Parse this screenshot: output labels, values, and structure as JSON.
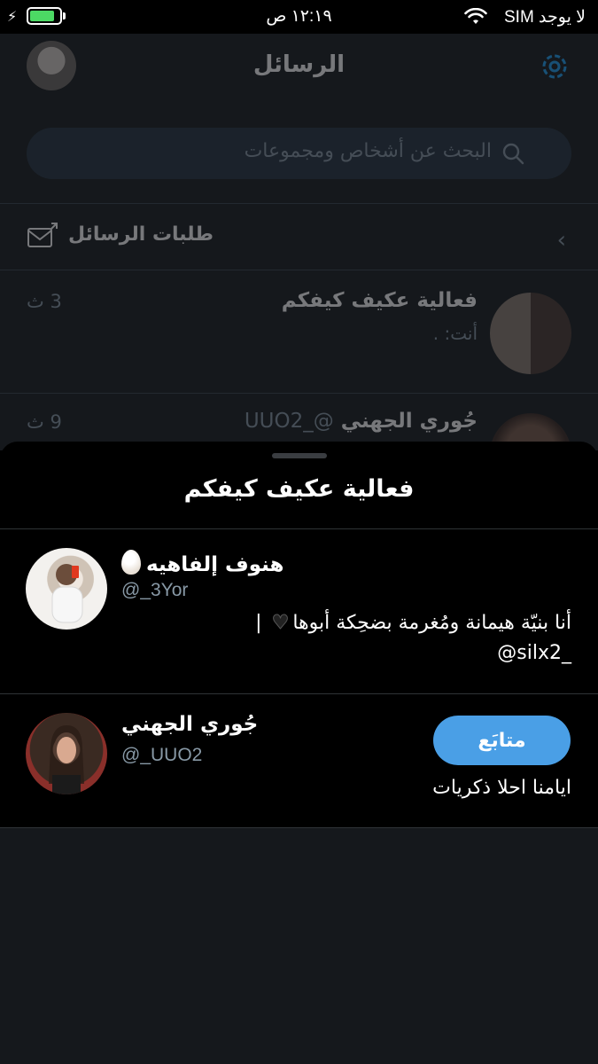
{
  "status_bar": {
    "carrier": "لا يوجد SIM",
    "time": "١٢:١٩ ص",
    "battery_level": 0.85
  },
  "background": {
    "title": "الرسائل",
    "search_placeholder": "البحث عن أشخاص ومجموعات",
    "message_requests": "طلبات الرسائل",
    "conversations": [
      {
        "name": "فعالية عكيف كيفكم",
        "handle": "",
        "preview": "أنت: .",
        "time": "3 ث"
      },
      {
        "name": "جُوري الجهني",
        "handle": "@_UUO2",
        "preview": "",
        "time": "9 ث"
      }
    ]
  },
  "sheet": {
    "title": "فعالية عكيف كيفكم",
    "members": [
      {
        "name": "هنوف إلفاهيه",
        "handle": "@_3Yor",
        "bio_line1": "أنا بنيّة هيمانة ومُغرمة بضحِكة أبوها",
        "bio_line1_suffix": "|",
        "bio_line2": "@silx2_"
      },
      {
        "name": "جُوري الجهني",
        "handle": "@_UUO2",
        "bio": "ايامنا احلا ذكريات",
        "follow_label": "متابَع"
      }
    ]
  },
  "colors": {
    "accent": "#4a9fe6",
    "background": "#000000",
    "muted_text": "#8899a6",
    "dim_background": "#15181c"
  }
}
